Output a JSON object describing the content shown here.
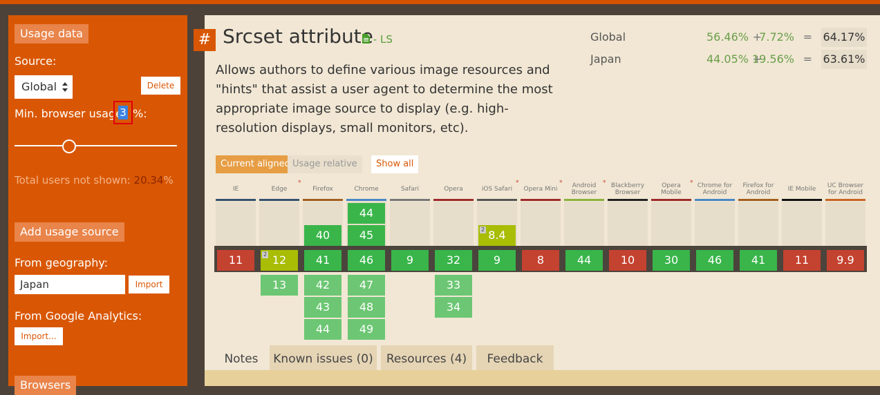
{
  "sidebar": {
    "usage_data_label": "Usage data",
    "source_label": "Source:",
    "source_value": "Global",
    "delete_label": "Delete",
    "min_usage_label_pre": "Min. browser usage:",
    "min_usage_value": "3",
    "min_usage_label_post": "%:",
    "slider_value_percent": 3,
    "total_not_shown_label": "Total users not shown:",
    "total_not_shown_value": "20.34",
    "total_not_shown_unit": "%",
    "add_usage_source_label": "Add usage source",
    "from_geography_label": "From geography:",
    "geography_value": "Japan",
    "import_label": "Import",
    "from_ga_label": "From Google Analytics:",
    "import_dots_label": "Import...",
    "browsers_label": "Browsers"
  },
  "feature": {
    "hash": "#",
    "title": "Srcset attribute",
    "spec_suffix": "- LS",
    "description": "Allows authors to define various image resources and \"hints\" that assist a user agent to determine the most appropriate image source to display (e.g. high-resolution displays, small monitors, etc)."
  },
  "stats": [
    {
      "region": "Global",
      "n1": "56.46%",
      "plus": "+",
      "n2": "7.72%",
      "eq": "=",
      "total": "64.17%"
    },
    {
      "region": "Japan",
      "n1": "44.05%",
      "plus": "+",
      "n2": "19.56%",
      "eq": "=",
      "total": "63.61%"
    }
  ],
  "view_tabs": {
    "current_aligned": "Current aligned",
    "usage_relative": "Usage relative",
    "show_all": "Show all"
  },
  "browsers": [
    {
      "name1": "IE",
      "name2": "",
      "color": "#34526c",
      "star": false
    },
    {
      "name1": "Edge",
      "name2": "",
      "color": "#34526c",
      "star": true
    },
    {
      "name1": "Firefox",
      "name2": "",
      "color": "#a45f1e",
      "star": false
    },
    {
      "name1": "Chrome",
      "name2": "",
      "color": "#4a87c5",
      "star": false
    },
    {
      "name1": "Safari",
      "name2": "",
      "color": "#777777",
      "star": false
    },
    {
      "name1": "Opera",
      "name2": "",
      "color": "#9e2b2b",
      "star": false
    },
    {
      "name1": "iOS Safari",
      "name2": "",
      "color": "#555555",
      "star": true
    },
    {
      "name1": "Opera Mini",
      "name2": "",
      "color": "#9e2b2b",
      "star": true
    },
    {
      "name1": "Android",
      "name2": "Browser",
      "color": "#8bb13c",
      "star": true
    },
    {
      "name1": "Blackberry",
      "name2": "Browser",
      "color": "#222222",
      "star": false
    },
    {
      "name1": "Opera",
      "name2": "Mobile",
      "color": "#9e2b2b",
      "star": true
    },
    {
      "name1": "Chrome for",
      "name2": "Android",
      "color": "#4a87c5",
      "star": false
    },
    {
      "name1": "Firefox for",
      "name2": "Android",
      "color": "#a45f1e",
      "star": false
    },
    {
      "name1": "IE Mobile",
      "name2": "",
      "color": "#111111",
      "star": false
    },
    {
      "name1": "UC Browser",
      "name2": "for Android",
      "color": "#c86424",
      "star": false
    }
  ],
  "past": [
    {
      "col": 2,
      "row": 1,
      "v": "40",
      "s": "y"
    },
    {
      "col": 3,
      "row": 0,
      "v": "44",
      "s": "y"
    },
    {
      "col": 3,
      "row": 1,
      "v": "45",
      "s": "y"
    },
    {
      "col": 6,
      "row": 1,
      "v": "8.4",
      "s": "a",
      "note": "2"
    }
  ],
  "current": [
    {
      "v": "11",
      "s": "n"
    },
    {
      "v": "12",
      "s": "a",
      "note": "2"
    },
    {
      "v": "41",
      "s": "y"
    },
    {
      "v": "46",
      "s": "y"
    },
    {
      "v": "9",
      "s": "y"
    },
    {
      "v": "32",
      "s": "y"
    },
    {
      "v": "9",
      "s": "y"
    },
    {
      "v": "8",
      "s": "n"
    },
    {
      "v": "44",
      "s": "y"
    },
    {
      "v": "10",
      "s": "n"
    },
    {
      "v": "30",
      "s": "y"
    },
    {
      "v": "46",
      "s": "y"
    },
    {
      "v": "41",
      "s": "y"
    },
    {
      "v": "11",
      "s": "n"
    },
    {
      "v": "9.9",
      "s": "n"
    }
  ],
  "future": [
    {
      "col": 1,
      "row": 0,
      "v": "13"
    },
    {
      "col": 2,
      "row": 0,
      "v": "42"
    },
    {
      "col": 2,
      "row": 1,
      "v": "43"
    },
    {
      "col": 2,
      "row": 2,
      "v": "44"
    },
    {
      "col": 3,
      "row": 0,
      "v": "47"
    },
    {
      "col": 3,
      "row": 1,
      "v": "48"
    },
    {
      "col": 3,
      "row": 2,
      "v": "49"
    },
    {
      "col": 5,
      "row": 0,
      "v": "33"
    },
    {
      "col": 5,
      "row": 1,
      "v": "34"
    }
  ],
  "bottom_tabs": [
    "Notes",
    "Known issues (0)",
    "Resources (4)",
    "Feedback"
  ]
}
